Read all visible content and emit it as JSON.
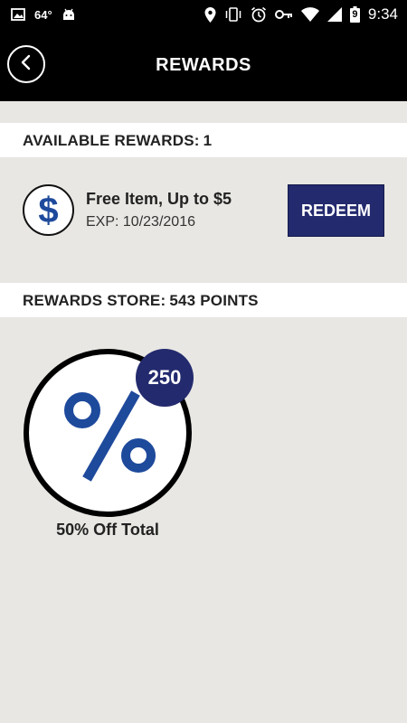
{
  "status_bar": {
    "temperature": "64°",
    "time": "9:34",
    "battery_level": "9",
    "icons": [
      "gallery-icon",
      "android-icon",
      "location-icon",
      "vibrate-icon",
      "alarm-icon",
      "key-icon",
      "wifi-icon",
      "signal-icon",
      "battery-icon"
    ]
  },
  "app_bar": {
    "title": "REWARDS",
    "back_icon": "chevron-left-icon"
  },
  "available_rewards": {
    "label": "AVAILABLE REWARDS:",
    "count": "1",
    "items": [
      {
        "icon": "dollar-icon",
        "icon_glyph": "$",
        "title": "Free Item, Up to $5",
        "expiration": "EXP: 10/23/2016",
        "button_label": "REDEEM"
      }
    ]
  },
  "rewards_store": {
    "label": "REWARDS STORE:",
    "points": "543 POINTS",
    "items": [
      {
        "icon": "percent-icon",
        "cost": "250",
        "label": "50% Off Total"
      }
    ]
  },
  "colors": {
    "header_bg": "#000000",
    "page_bg": "#e8e7e3",
    "section_bg": "#ffffff",
    "accent_navy": "#232a6e",
    "icon_blue": "#1e4a9c"
  }
}
